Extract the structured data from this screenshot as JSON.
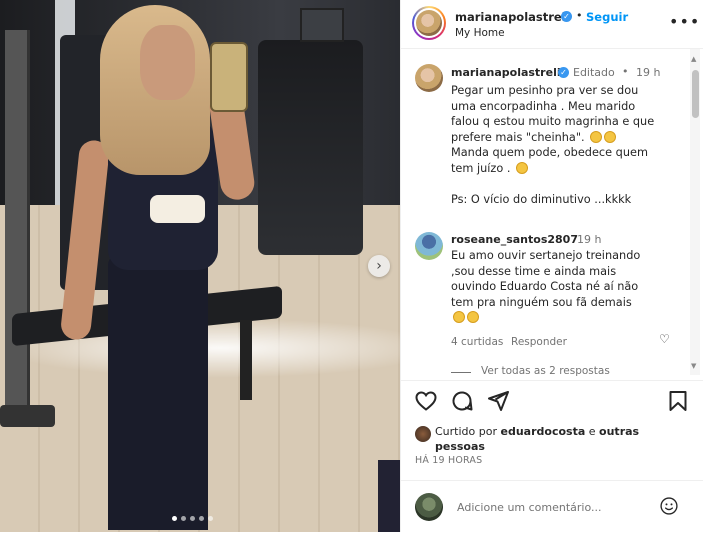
{
  "post_header": {
    "username": "marianapolastreli",
    "separator": "•",
    "follow_label": "Seguir",
    "location": "My Home",
    "more_icon": "more-icon"
  },
  "caption": {
    "username": "marianapolastreli",
    "edited_label": "Editado",
    "separator": "•",
    "time": "19 h",
    "text_lines": [
      "Pegar um pesinho pra ver se dou",
      "uma encorpadinha . Meu marido",
      "falou q estou muito magrinha e que",
      "prefere mais \"cheinha\".",
      "Manda quem pode, obedece quem",
      "tem juízo .",
      "",
      "Ps: O vício do diminutivo ...kkkk"
    ]
  },
  "comment": {
    "username": "roseane_santos2807",
    "time": "19 h",
    "text_lines": [
      "Eu amo ouvir sertanejo treinando",
      ",sou desse time e ainda mais",
      "ouvindo Eduardo Costa né aí não",
      "tem pra ninguém sou fã demais"
    ],
    "likes_label": "4 curtidas",
    "reply_label": "Responder",
    "view_replies_label": "Ver todas as 2 respostas"
  },
  "liked_by": {
    "prefix": "Curtido por",
    "user": "eduardocosta",
    "connector": "e",
    "rest": "outras pessoas"
  },
  "time_ago": "HÁ 19 HORAS",
  "add_comment": {
    "placeholder": "Adicione um comentário..."
  },
  "carousel": {
    "dots": 5,
    "active_index": 0,
    "next_icon": "chevron-right-icon"
  },
  "icons": {
    "like": "heart-icon",
    "comment": "comment-icon",
    "share": "paper-plane-icon",
    "save": "bookmark-icon",
    "emoji": "smile-icon"
  },
  "colors": {
    "accent": "#0095f6",
    "verified": "#3897f0",
    "text": "#262626",
    "muted": "#737373"
  }
}
